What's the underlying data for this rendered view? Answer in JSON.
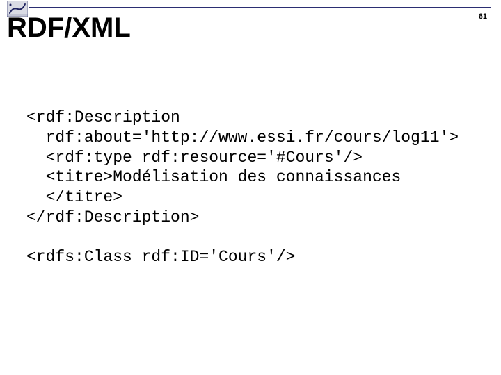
{
  "page_number": "61",
  "title": "RDF/XML",
  "code": {
    "l1": "<rdf:Description",
    "l2": "  rdf:about='http://www.essi.fr/cours/log11'>",
    "l3": "  <rdf:type rdf:resource='#Cours'/>",
    "l4": "  <titre>Modélisation des connaissances",
    "l5": "  </titre>",
    "l6": "</rdf:Description>",
    "l7": "",
    "l8": "<rdfs:Class rdf:ID='Cours'/>"
  }
}
